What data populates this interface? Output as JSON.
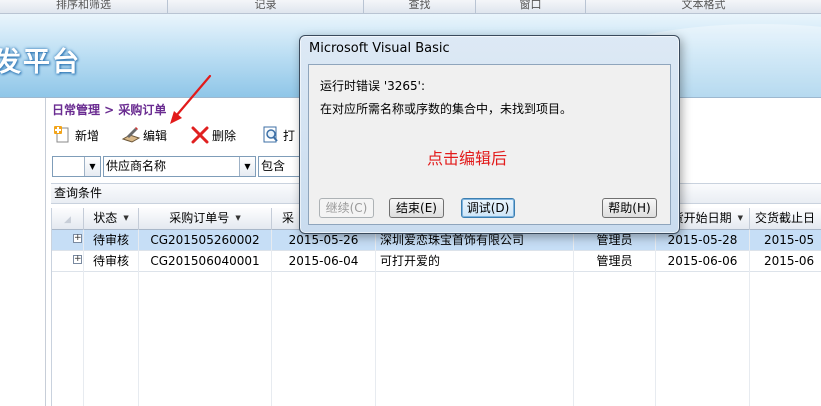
{
  "ribbon": {
    "groups": [
      "排序和筛选",
      "记录",
      "查找",
      "窗口",
      "文本格式"
    ]
  },
  "banner": {
    "title": "发平台"
  },
  "breadcrumb": "日常管理 > 采购订单",
  "toolbar": {
    "add": "新增",
    "edit": "编辑",
    "delete": "删除",
    "print": "打"
  },
  "filter": {
    "combo1": "",
    "field": "供应商名称",
    "operator": "包含"
  },
  "query_label": "查询条件",
  "grid": {
    "columns": [
      "状态",
      "采购订单号",
      "采",
      "",
      "",
      "货开始日期",
      "交货截止日"
    ],
    "rows": [
      {
        "status": "待审核",
        "order_no": "CG201505260002",
        "date": "2015-05-26",
        "supplier": "深圳爱恋珠宝首饰有限公司",
        "operator": "管理员",
        "start": "2015-05-28",
        "end": "2015-05"
      },
      {
        "status": "待审核",
        "order_no": "CG201506040001",
        "date": "2015-06-04",
        "supplier": "可打开爱的",
        "operator": "管理员",
        "start": "2015-06-06",
        "end": "2015-06"
      }
    ]
  },
  "dialog": {
    "title": "Microsoft Visual Basic",
    "message1": "运行时错误 '3265':",
    "message2": "在对应所需名称或序数的集合中，未找到项目。",
    "annotation": "点击编辑后",
    "buttons": {
      "continue": "继续(C)",
      "end": "结束(E)",
      "debug": "调试(D)",
      "help": "帮助(H)"
    }
  },
  "colors": {
    "breadcrumb": "#6a2c91",
    "selected_row": "#c6def6",
    "annotation": "#e21b1b",
    "arrow": "#e21b1b"
  }
}
